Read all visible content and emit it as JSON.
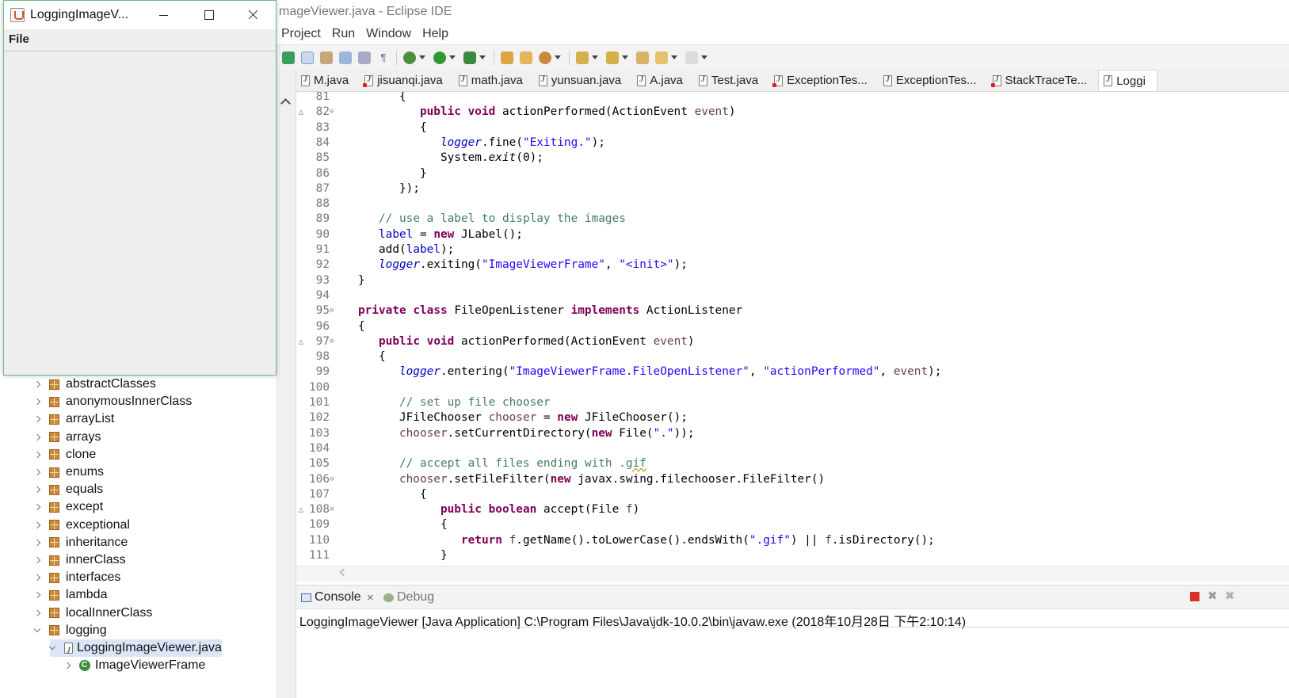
{
  "eclipse": {
    "title": "mageViewer.java - Eclipse IDE",
    "menu": [
      "Project",
      "Run",
      "Window",
      "Help"
    ]
  },
  "editor_tabs": [
    {
      "label": "M.java",
      "error": false
    },
    {
      "label": "jisuanqi.java",
      "error": true
    },
    {
      "label": "math.java",
      "error": false
    },
    {
      "label": "yunsuan.java",
      "error": false
    },
    {
      "label": "A.java",
      "error": false
    },
    {
      "label": "Test.java",
      "error": false
    },
    {
      "label": "ExceptionTes...",
      "error": true
    },
    {
      "label": "ExceptionTes...",
      "error": false
    },
    {
      "label": "StackTraceTe...",
      "error": true
    },
    {
      "label": "Loggi",
      "error": false,
      "active": true
    }
  ],
  "code_lines": [
    {
      "n": "81",
      "fold": "",
      "ovr": "",
      "html": "      {"
    },
    {
      "n": "82",
      "fold": "⊖",
      "ovr": "△",
      "html": "         <span class=\"kw\">public</span> <span class=\"kw\">void</span> actionPerformed(ActionEvent <span class=\"prm\">event</span>)"
    },
    {
      "n": "83",
      "fold": "",
      "ovr": "",
      "html": "         {"
    },
    {
      "n": "84",
      "fold": "",
      "ovr": "",
      "html": "            <span class=\"sfld\">logger</span>.fine(<span class=\"str\">\"Exiting.\"</span>);"
    },
    {
      "n": "85",
      "fold": "",
      "ovr": "",
      "html": "            System.<span class=\"sm\">exit</span>(0);"
    },
    {
      "n": "86",
      "fold": "",
      "ovr": "",
      "html": "         }"
    },
    {
      "n": "87",
      "fold": "",
      "ovr": "",
      "html": "      });"
    },
    {
      "n": "88",
      "fold": "",
      "ovr": "",
      "html": ""
    },
    {
      "n": "89",
      "fold": "",
      "ovr": "",
      "html": "   <span class=\"cm\">// use a label to display the images</span>"
    },
    {
      "n": "90",
      "fold": "",
      "ovr": "",
      "html": "   <span class=\"fld\">label</span> = <span class=\"kw\">new</span> JLabel();"
    },
    {
      "n": "91",
      "fold": "",
      "ovr": "",
      "html": "   add(<span class=\"fld\">label</span>);"
    },
    {
      "n": "92",
      "fold": "",
      "ovr": "",
      "html": "   <span class=\"sfld\">logger</span>.exiting(<span class=\"str\">\"ImageViewerFrame\"</span>, <span class=\"str\">\"&lt;init&gt;\"</span>);"
    },
    {
      "n": "93",
      "fold": "",
      "ovr": "",
      "html": "}"
    },
    {
      "n": "94",
      "fold": "",
      "ovr": "",
      "html": ""
    },
    {
      "n": "95",
      "fold": "⊖",
      "ovr": "",
      "html": "<span class=\"kw\">private</span> <span class=\"kw\">class</span> FileOpenListener <span class=\"kw\">implements</span> ActionListener"
    },
    {
      "n": "96",
      "fold": "",
      "ovr": "",
      "html": "{"
    },
    {
      "n": "97",
      "fold": "⊖",
      "ovr": "△",
      "html": "   <span class=\"kw\">public</span> <span class=\"kw\">void</span> actionPerformed(ActionEvent <span class=\"prm\">event</span>)"
    },
    {
      "n": "98",
      "fold": "",
      "ovr": "",
      "html": "   {"
    },
    {
      "n": "99",
      "fold": "",
      "ovr": "",
      "html": "      <span class=\"sfld\">logger</span>.entering(<span class=\"str\">\"ImageViewerFrame.FileOpenListener\"</span>, <span class=\"str\">\"actionPerformed\"</span>, <span class=\"prm\">event</span>);"
    },
    {
      "n": "100",
      "fold": "",
      "ovr": "",
      "html": ""
    },
    {
      "n": "101",
      "fold": "",
      "ovr": "",
      "html": "      <span class=\"cm\">// set up file chooser</span>"
    },
    {
      "n": "102",
      "fold": "",
      "ovr": "",
      "html": "      JFileChooser <span class=\"prm\">chooser</span> = <span class=\"kw\">new</span> JFileChooser();"
    },
    {
      "n": "103",
      "fold": "",
      "ovr": "",
      "html": "      <span class=\"prm\">chooser</span>.setCurrentDirectory(<span class=\"kw\">new</span> File(<span class=\"str\">\".\"</span>));"
    },
    {
      "n": "104",
      "fold": "",
      "ovr": "",
      "html": ""
    },
    {
      "n": "105",
      "fold": "",
      "ovr": "",
      "html": "      <span class=\"cm\">// accept all files ending with .<span class=\"sp\">gif</span></span>"
    },
    {
      "n": "106",
      "fold": "⊖",
      "ovr": "",
      "html": "      <span class=\"prm\">chooser</span>.setFileFilter(<span class=\"kw\">new</span> javax.swing.filechooser.FileFilter()"
    },
    {
      "n": "107",
      "fold": "",
      "ovr": "",
      "html": "         {"
    },
    {
      "n": "108",
      "fold": "⊖",
      "ovr": "△",
      "html": "            <span class=\"kw\">public</span> <span class=\"kw\">boolean</span> accept(File <span class=\"prm\">f</span>)"
    },
    {
      "n": "109",
      "fold": "",
      "ovr": "",
      "html": "            {"
    },
    {
      "n": "110",
      "fold": "",
      "ovr": "",
      "html": "               <span class=\"kw\">return</span> <span class=\"prm\">f</span>.getName().toLowerCase().endsWith(<span class=\"str\">\".gif\"</span>) || <span class=\"prm\">f</span>.isDirectory();"
    },
    {
      "n": "111",
      "fold": "",
      "ovr": "",
      "html": "            }"
    }
  ],
  "console": {
    "tab_console": "Console",
    "tab_console_close": "✕",
    "tab_debug": "Debug",
    "description": "LoggingImageViewer [Java Application] C:\\Program Files\\Java\\jdk-10.0.2\\bin\\javaw.exe (2018年10月28日 下午2:10:14)",
    "colors": {
      "terminate": "#d9322a",
      "remove": "#9a9a9a"
    }
  },
  "package_tree": [
    {
      "label": "abstractClasses",
      "depth": 1,
      "icon": "package-icon",
      "expanded": false
    },
    {
      "label": "anonymousInnerClass",
      "depth": 1,
      "icon": "package-icon",
      "expanded": false
    },
    {
      "label": "arrayList",
      "depth": 1,
      "icon": "package-icon",
      "expanded": false
    },
    {
      "label": "arrays",
      "depth": 1,
      "icon": "package-icon",
      "expanded": false
    },
    {
      "label": "clone",
      "depth": 1,
      "icon": "package-icon",
      "expanded": false
    },
    {
      "label": "enums",
      "depth": 1,
      "icon": "package-icon",
      "expanded": false
    },
    {
      "label": "equals",
      "depth": 1,
      "icon": "package-icon",
      "expanded": false
    },
    {
      "label": "except",
      "depth": 1,
      "icon": "package-icon",
      "expanded": false
    },
    {
      "label": "exceptional",
      "depth": 1,
      "icon": "package-icon",
      "expanded": false
    },
    {
      "label": "inheritance",
      "depth": 1,
      "icon": "package-icon",
      "expanded": false
    },
    {
      "label": "innerClass",
      "depth": 1,
      "icon": "package-icon",
      "expanded": false
    },
    {
      "label": "interfaces",
      "depth": 1,
      "icon": "package-icon",
      "expanded": false
    },
    {
      "label": "lambda",
      "depth": 1,
      "icon": "package-icon",
      "expanded": false
    },
    {
      "label": "localInnerClass",
      "depth": 1,
      "icon": "package-icon",
      "expanded": false
    },
    {
      "label": "logging",
      "depth": 1,
      "icon": "package-icon",
      "expanded": true
    },
    {
      "label": "LoggingImageViewer.java",
      "depth": 2,
      "icon": "java-file-icon",
      "expanded": true,
      "selected": true
    },
    {
      "label": "ImageViewerFrame",
      "depth": 3,
      "icon": "class-icon",
      "expanded": false
    }
  ],
  "java_window": {
    "title": "LoggingImageV...",
    "menu_file": "File"
  }
}
